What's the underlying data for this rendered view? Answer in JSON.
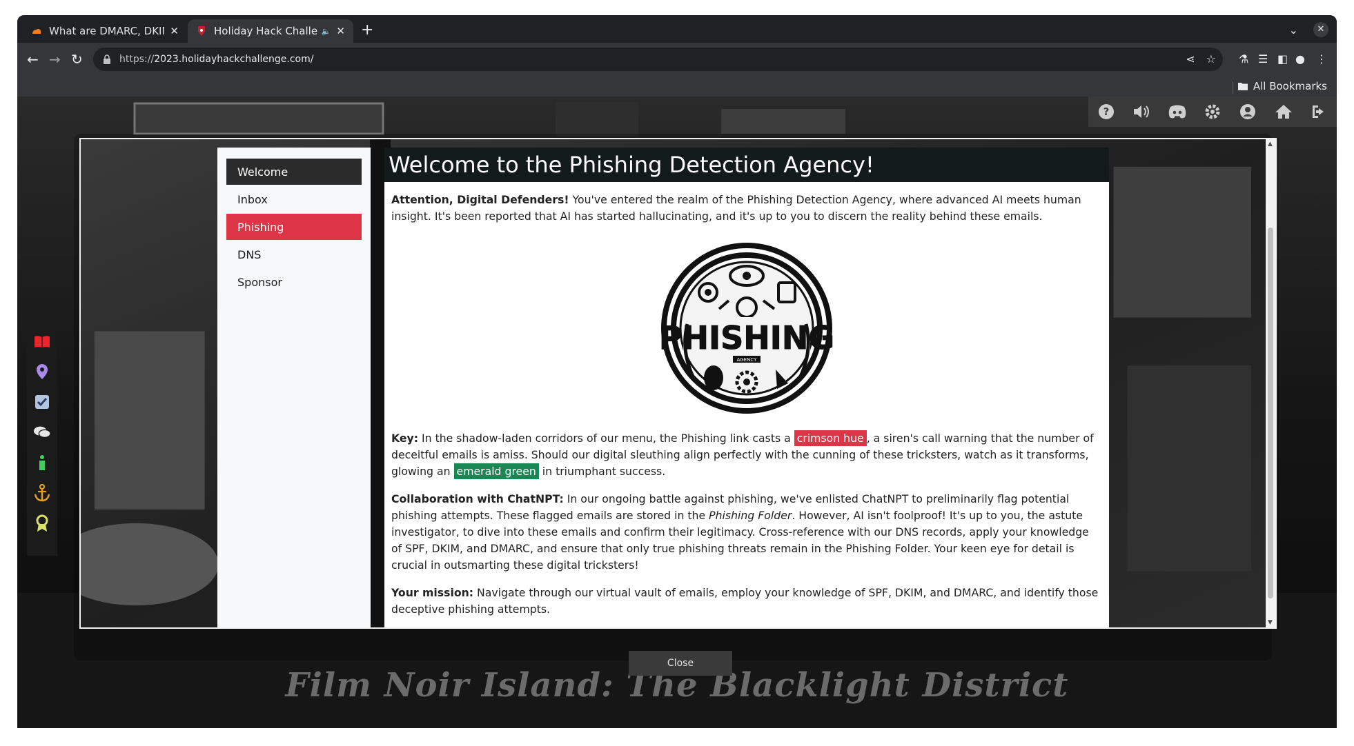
{
  "browser": {
    "tabs": [
      {
        "title": "What are DMARC, DKIM",
        "favicon": "cloudflare-icon"
      },
      {
        "title": "Holiday Hack Challe",
        "favicon": "holidayhack-icon",
        "audio": true
      }
    ],
    "new_tab": "+",
    "tab_search": "⌄",
    "close_window": "✕",
    "url_scheme": "https://",
    "url_host": "2023.holidayhackchallenge.com/",
    "bookmarks_label": "All Bookmarks"
  },
  "game": {
    "top_icons": [
      "help-icon",
      "volume-icon",
      "discord-icon",
      "settings-icon",
      "user-icon",
      "home-icon",
      "logout-icon"
    ],
    "side_icons": [
      "book-icon",
      "location-icon",
      "checklist-icon",
      "chat-icon",
      "info-icon",
      "anchor-icon",
      "badge-icon"
    ],
    "location_title": "Film Noir Island: The Blacklight District",
    "close_label": "Close"
  },
  "terminal": {
    "nav": [
      "Welcome",
      "Inbox",
      "Phishing",
      "DNS",
      "Sponsor"
    ],
    "header": "Welcome to the Phishing Detection Agency!",
    "p1_bold": "Attention, Digital Defenders!",
    "p1_text": " You've entered the realm of the Phishing Detection Agency, where advanced AI meets human insight. It's been reported that AI has started hallucinating, and it's up to you to discern the reality behind these emails.",
    "logo_text": "PHISHING",
    "logo_sub": "AGENCY",
    "key_bold": "Key:",
    "key_text1": " In the shadow-laden corridors of our menu, the Phishing link casts a ",
    "crimson": "crimson hue",
    "key_text2": ", a siren's call warning that the number of deceitful emails is amiss. Should our digital sleuthing align perfectly with the cunning of these tricksters, watch as it transforms, glowing an ",
    "emerald": "emerald green",
    "key_text3": " in triumphant success.",
    "collab_bold": "Collaboration with ChatNPT:",
    "collab_text1": " In our ongoing battle against phishing, we've enlisted ChatNPT to preliminarily flag potential phishing attempts. These flagged emails are stored in the ",
    "collab_italic": "Phishing Folder",
    "collab_text2": ". However, AI isn't foolproof! It's up to you, the astute investigator, to dive into these emails and confirm their legitimacy. Cross-reference with our DNS records, apply your knowledge of SPF, DKIM, and DMARC, and ensure that only true phishing threats remain in the Phishing Folder. Your keen eye for detail is crucial in outsmarting these digital tricksters!",
    "mission_bold": "Your mission:",
    "mission_text": " Navigate through our virtual vault of emails, employ your knowledge of SPF, DKIM, and DMARC, and identify those deceptive phishing attempts."
  },
  "colors": {
    "phishing_nav": "#dc3545",
    "crimson": "#dc3545",
    "emerald": "#198754",
    "active_nav": "#2b2b2b"
  }
}
